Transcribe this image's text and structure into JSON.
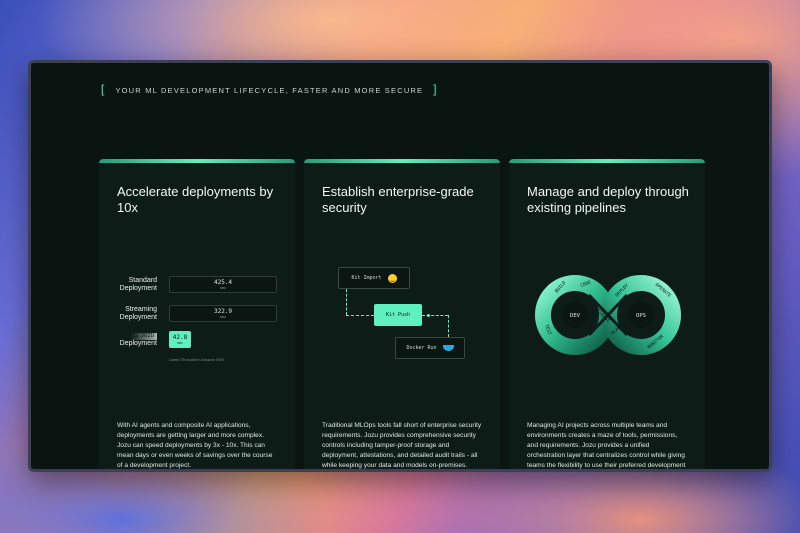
{
  "eyebrow": {
    "open_bracket": "[",
    "text": "YOUR ML DEVELOPMENT LIFECYCLE, FASTER AND MORE SECURE",
    "close_bracket": "]"
  },
  "cards": [
    {
      "title": "Accelerate deployments by 10x",
      "benchmarks": [
        {
          "label": "Standard Deployment",
          "value": "425.4",
          "unit": "sec"
        },
        {
          "label": "Streaming Deployment",
          "value": "322.9",
          "unit": "sec"
        },
        {
          "label": "Deployment",
          "tag": "⊔ JOZU",
          "value": "42.8",
          "unit": "sec"
        }
      ],
      "footnote": "Llama 7B model in Amazon EKS",
      "body": "With AI agents and composite AI applications, deployments are getting larger and more complex. Jozu can speed deployments by 3x - 10x. This can mean days or even weeks of savings over the course of a development project."
    },
    {
      "title": "Establish enterprise-grade security",
      "flow": {
        "import": "Kit Import",
        "push": "Kit Push",
        "docker": "Docker Run"
      },
      "body": "Traditional MLOps tools fall short of enterprise security requirements. Jozu provides comprehensive security controls including tamper-proof storage and deployment, attestations, and detailed audit trails - all while keeping your data and models on-premises."
    },
    {
      "title": "Manage and deploy through existing pipelines",
      "loop": {
        "left_center": "DEV",
        "right_center": "OPS",
        "left_segments": [
          "BUILD",
          "CODE",
          "TEST"
        ],
        "cross_segments": [
          "RELEASE",
          "PLAN"
        ],
        "right_segments": [
          "DEPLOY",
          "OPERATE",
          "MONITOR"
        ]
      },
      "body": "Managing AI projects across multiple teams and environments creates a maze of tools, permissions, and requirements. Jozu provides a unified orchestration layer that centralizes control while giving teams the flexibility to use their preferred development tools."
    }
  ],
  "colors": {
    "accent": "#5ff0c0",
    "background": "#0a1512",
    "card": "#0e1c18"
  }
}
